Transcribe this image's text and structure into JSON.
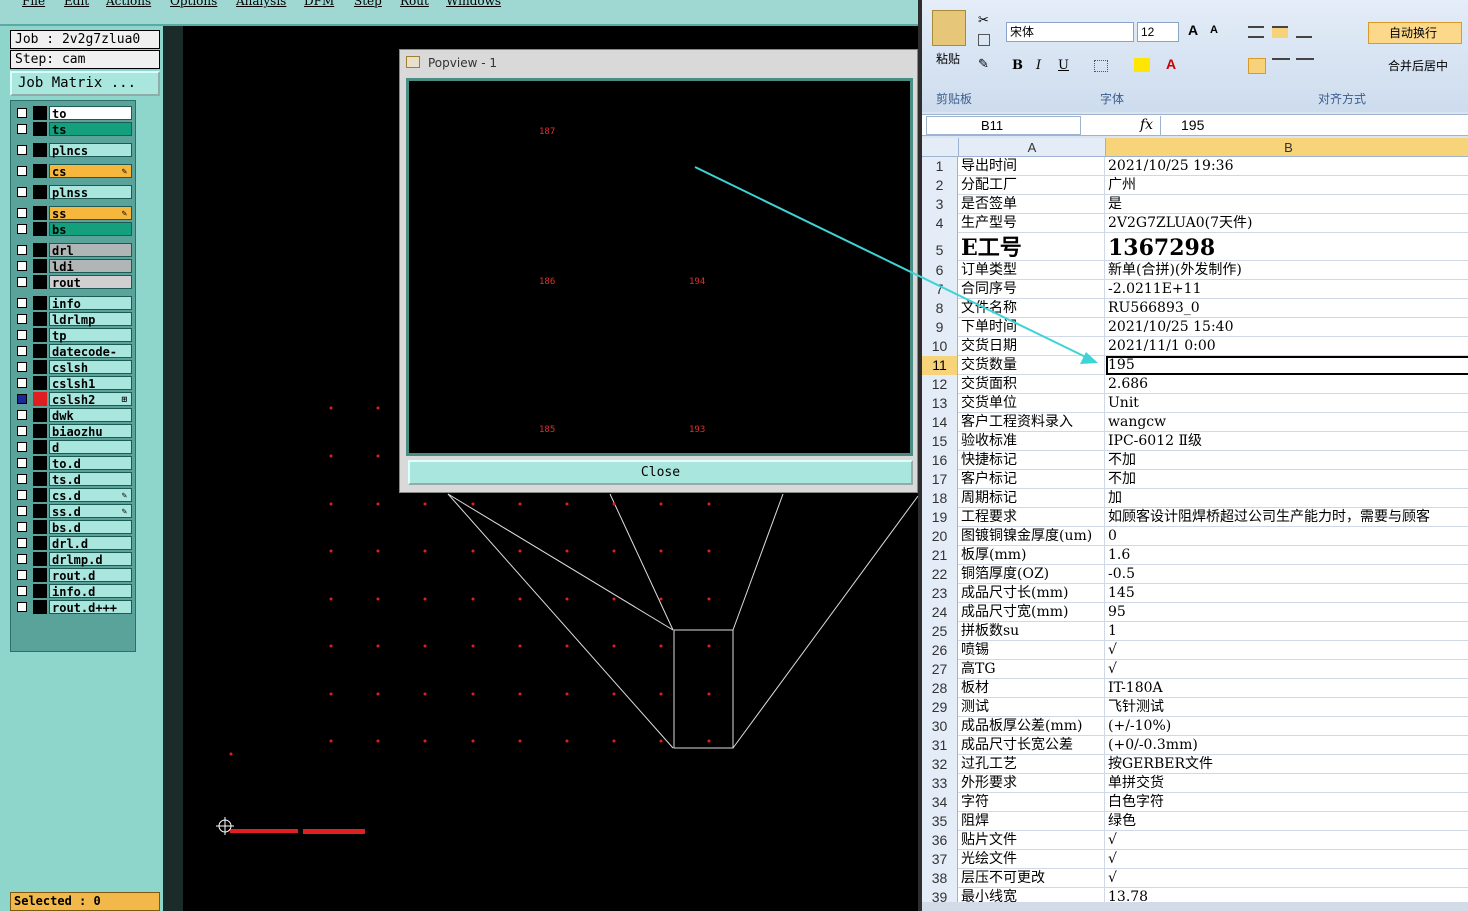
{
  "genesis": {
    "menu": [
      "File",
      "Edit",
      "Actions",
      "Options",
      "Analysis",
      "DFM",
      "Step",
      "Rout",
      "Windows"
    ],
    "job_label": "Job : 2v2g7zlua0",
    "step_label": "Step: cam",
    "job_matrix_label": "Job Matrix ...",
    "selected_label": "Selected : 0",
    "layers": [
      {
        "name": "to",
        "color": "#ffffff",
        "tag": ""
      },
      {
        "name": "ts",
        "color": "#14a07c",
        "tag": ""
      },
      {
        "name": "plncs",
        "color": "#a9e6de",
        "tag": ""
      },
      {
        "name": "cs",
        "color": "#f7b63c",
        "tag": "✎"
      },
      {
        "name": "plnss",
        "color": "#a9e6de",
        "tag": ""
      },
      {
        "name": "ss",
        "color": "#f7b63c",
        "tag": "✎"
      },
      {
        "name": "bs",
        "color": "#14a07c",
        "tag": ""
      },
      {
        "name": "drl",
        "color": "#b0b6b5",
        "tag": ""
      },
      {
        "name": "ldi",
        "color": "#b0b6b5",
        "tag": ""
      },
      {
        "name": "rout",
        "color": "#d0d0d0",
        "tag": ""
      },
      {
        "name": "info",
        "color": "#a9e6de",
        "tag": ""
      },
      {
        "name": "ldrlmp",
        "color": "#a9e6de",
        "tag": ""
      },
      {
        "name": "tp",
        "color": "#a9e6de",
        "tag": ""
      },
      {
        "name": "datecode-to",
        "color": "#a9e6de",
        "tag": ""
      },
      {
        "name": "cslsh",
        "color": "#a9e6de",
        "tag": ""
      },
      {
        "name": "cslsh1",
        "color": "#a9e6de",
        "tag": ""
      },
      {
        "name": "cslsh2",
        "color": "#a9e6de",
        "tag": "⊞"
      },
      {
        "name": "dwk",
        "color": "#a9e6de",
        "tag": ""
      },
      {
        "name": "biaozhu",
        "color": "#a9e6de",
        "tag": ""
      },
      {
        "name": "d",
        "color": "#a9e6de",
        "tag": ""
      },
      {
        "name": "to.d",
        "color": "#a9e6de",
        "tag": ""
      },
      {
        "name": "ts.d",
        "color": "#a9e6de",
        "tag": ""
      },
      {
        "name": "cs.d",
        "color": "#a9e6de",
        "tag": "✎"
      },
      {
        "name": "ss.d",
        "color": "#a9e6de",
        "tag": "✎"
      },
      {
        "name": "bs.d",
        "color": "#a9e6de",
        "tag": ""
      },
      {
        "name": "drl.d",
        "color": "#a9e6de",
        "tag": ""
      },
      {
        "name": "drlmp.d",
        "color": "#a9e6de",
        "tag": ""
      },
      {
        "name": "rout.d",
        "color": "#a9e6de",
        "tag": ""
      },
      {
        "name": "info.d",
        "color": "#a9e6de",
        "tag": ""
      },
      {
        "name": "rout.d+++",
        "color": "#a9e6de",
        "tag": ""
      }
    ],
    "popview": {
      "title": "Popview - 1",
      "close_label": "Close",
      "labels": [
        "187",
        "186",
        "194",
        "185",
        "193"
      ]
    }
  },
  "excel": {
    "font_name": "宋体",
    "font_size": "12",
    "wrap_label": "自动换行",
    "merge_label": "合并后居中",
    "paste_label": "粘贴",
    "group_clipboard": "剪贴板",
    "group_font": "字体",
    "group_align": "对齐方式",
    "name_box": "B11",
    "fx": "fx",
    "formula_value": "195",
    "col_a": "A",
    "col_b": "B",
    "rows": [
      {
        "n": "1",
        "a": "导出时间",
        "b": "2021/10/25 19:36"
      },
      {
        "n": "2",
        "a": "分配工厂",
        "b": "广州"
      },
      {
        "n": "3",
        "a": "是否签单",
        "b": "是"
      },
      {
        "n": "4",
        "a": "生产型号",
        "b": "2V2G7ZLUA0(7天件)"
      },
      {
        "n": "5",
        "a": "E工号",
        "b": "1367298"
      },
      {
        "n": "6",
        "a": "订单类型",
        "b": "新单(合拼)(外发制作)"
      },
      {
        "n": "7",
        "a": "合同序号",
        "b": "-2.0211E+11"
      },
      {
        "n": "8",
        "a": "文件名称",
        "b": "RU566893_0"
      },
      {
        "n": "9",
        "a": "下单时间",
        "b": "2021/10/25 15:40"
      },
      {
        "n": "10",
        "a": "交货日期",
        "b": "2021/11/1 0:00"
      },
      {
        "n": "11",
        "a": "交货数量",
        "b": "195"
      },
      {
        "n": "12",
        "a": "交货面积",
        "b": "2.686"
      },
      {
        "n": "13",
        "a": "交货单位",
        "b": "Unit"
      },
      {
        "n": "14",
        "a": "客户工程资料录入",
        "b": "wangcw"
      },
      {
        "n": "15",
        "a": "验收标准",
        "b": "IPC-6012 Ⅱ级"
      },
      {
        "n": "16",
        "a": "快捷标记",
        "b": "不加"
      },
      {
        "n": "17",
        "a": "客户标记",
        "b": "不加"
      },
      {
        "n": "18",
        "a": "周期标记",
        "b": "加"
      },
      {
        "n": "19",
        "a": "工程要求",
        "b": "如顾客设计阻焊桥超过公司生产能力时，需要与顾客"
      },
      {
        "n": "20",
        "a": "图镀铜镍金厚度(um)",
        "b": "0"
      },
      {
        "n": "21",
        "a": "板厚(mm)",
        "b": "1.6"
      },
      {
        "n": "22",
        "a": "铜箔厚度(OZ)",
        "b": "-0.5"
      },
      {
        "n": "23",
        "a": "成品尺寸长(mm)",
        "b": "145"
      },
      {
        "n": "24",
        "a": "成品尺寸宽(mm)",
        "b": "95"
      },
      {
        "n": "25",
        "a": "拼板数su",
        "b": "1"
      },
      {
        "n": "26",
        "a": "喷锡",
        "b": "√"
      },
      {
        "n": "27",
        "a": "高TG",
        "b": "√"
      },
      {
        "n": "28",
        "a": "板材",
        "b": "IT-180A"
      },
      {
        "n": "29",
        "a": "测试",
        "b": "飞针测试"
      },
      {
        "n": "30",
        "a": "成品板厚公差(mm)",
        "b": "(+/-10%)"
      },
      {
        "n": "31",
        "a": "成品尺寸长宽公差",
        "b": "(+0/-0.3mm)"
      },
      {
        "n": "32",
        "a": "过孔工艺",
        "b": "按GERBER文件"
      },
      {
        "n": "33",
        "a": "外形要求",
        "b": "单拼交货"
      },
      {
        "n": "34",
        "a": "字符",
        "b": "白色字符"
      },
      {
        "n": "35",
        "a": "阻焊",
        "b": "绿色"
      },
      {
        "n": "36",
        "a": "贴片文件",
        "b": "√"
      },
      {
        "n": "37",
        "a": "光绘文件",
        "b": "√"
      },
      {
        "n": "38",
        "a": "层压不可更改",
        "b": "√"
      },
      {
        "n": "39",
        "a": "最小线宽",
        "b": "13.78"
      }
    ]
  }
}
